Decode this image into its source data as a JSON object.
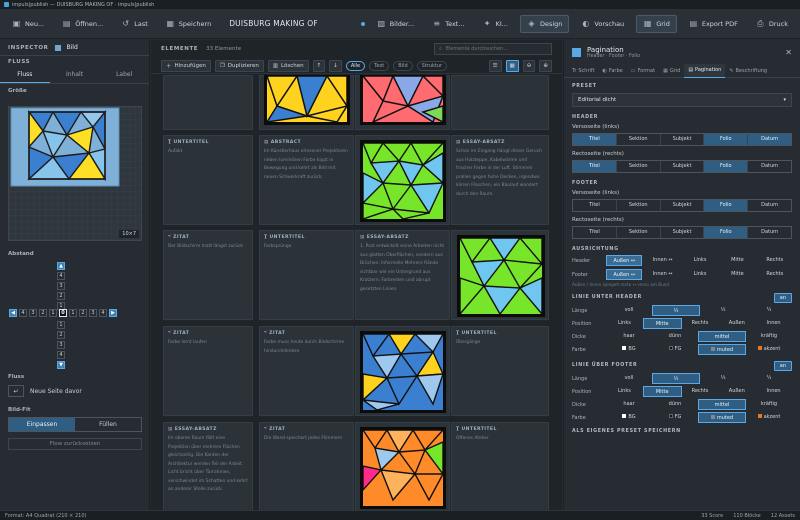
{
  "window_title": "impuls|publish — DUISBURG MAKING OF · impuls|publish",
  "toolbar": {
    "new": "Neu...",
    "open": "Öffnen...",
    "last": "Last",
    "save": "Speichern",
    "doc_title": "DUISBURG MAKING OF",
    "images": "Bilder...",
    "text": "Text...",
    "ki": "KI...",
    "design": "Design",
    "preview": "Vorschau",
    "grid": "Grid",
    "export": "Export PDF",
    "print": "Druck"
  },
  "inspector": {
    "title": "INSPECTOR",
    "object": "Bild",
    "section_flow": "FLUSS",
    "tabs": [
      "Fluss",
      "Inhalt",
      "Label"
    ],
    "size_label": "Größe",
    "size_value": "10×7",
    "spacing_label": "Abstand",
    "spacing_vertical_top": [
      "4",
      "3",
      "2",
      "1"
    ],
    "spacing_vertical_bottom": [
      "1",
      "2",
      "3",
      "4"
    ],
    "spacing_left": [
      "4",
      "3",
      "2",
      "1"
    ],
    "spacing_center": "0",
    "spacing_right": [
      "1",
      "2",
      "3",
      "4"
    ],
    "flow_label": "Fluss",
    "flow_option": "Neue Seite davor",
    "fit_label": "Bild-Fit",
    "fit_options": [
      "Einpassen",
      "Füllen"
    ],
    "reset_flow": "Flow zurücksetzen"
  },
  "elements": {
    "title": "ELEMENTE",
    "count": "33 Elemente",
    "search_placeholder": "Elemente durchsuchen...",
    "add": "Hinzufügen",
    "duplicate": "Duplizieren",
    "delete": "Löschen",
    "filters": [
      "Alle",
      "Text",
      "Bild",
      "Struktur"
    ],
    "cards": [
      {
        "tag": "UNTERTITEL",
        "text": "Aufakt"
      },
      {
        "tag": "ABSTRACT",
        "text": "Im Künstlerhaus erlesener Projektoren neben luminösen Farbe kippt in Bewegung und kehrt als Bild mit neuen Schwerkraft zurück."
      },
      {
        "tag": "ESSAY-ABSATZ",
        "text": "Schon im Eingang hängt dieser Geruch aus Holzteppe, Kabelwärme und frischer Farbe in der Luft. Stimmen prallen gegen hohe Decken, irgendwo klirren Flaschen, ein Baulauf wandert durch den Raum."
      },
      {
        "tag": "ZITAT",
        "text": "Der Bildschirm matt längst zurück"
      },
      {
        "tag": "UNTERTITEL",
        "text": "Farbsprünge"
      },
      {
        "tag": "ESSAY-ABSATZ",
        "text": "1. Post entwickelt seine Arbeiten nicht aus glatten Oberflächen, sondern aus Brüchen. Informelle Mehrere Rände sichtbar wie ein Untergrund aus Kratzern, Farbresten und abrupt gesetzten Linien."
      },
      {
        "tag": "ZITAT",
        "text": "Farbe lernt laufen"
      },
      {
        "tag": "ZITAT",
        "text": "Farbe muss heute durch Bildschirme hindurchdenken"
      },
      {
        "tag": "UNTERTITEL",
        "text": "Übergänge"
      },
      {
        "tag": "ESSAY-ABSATZ",
        "text": "Im oberen Raum fällt eine Projektion über mehrere Flächen gleichzeitig. Die Kanten der Architektur werden Teil der Arbeit. Licht bricht über Türrahmen, verschwindet im Schatten und kehrt an anderer Stelle zurück."
      },
      {
        "tag": "ZITAT",
        "text": "Die Wand speichert jedes Flimmern"
      },
      {
        "tag": "UNTERTITEL",
        "text": "Offenes Atelier"
      }
    ]
  },
  "pagination": {
    "title": "Pagination",
    "subtitle": "Header · Footer · Folio",
    "tabs": [
      "Schrift",
      "Farbe",
      "Format",
      "Grid",
      "Pagination",
      "Beschriftung"
    ],
    "preset_label": "PRESET",
    "preset_value": "Editorial dicht",
    "header_label": "HEADER",
    "verso_label": "Versoseite (links)",
    "recto_label": "Rectoseite (rechts)",
    "header_verso": [
      "Titel",
      "Sektion",
      "Subjekt",
      "Folio",
      "Datum"
    ],
    "header_recto": [
      "Titel",
      "Sektion",
      "Subjekt",
      "Folio",
      "Datum"
    ],
    "footer_label": "FOOTER",
    "footer_verso": [
      "Titel",
      "Sektion",
      "Subjekt",
      "Folio",
      "Datum"
    ],
    "footer_recto": [
      "Titel",
      "Sektion",
      "Subjekt",
      "Folio",
      "Datum"
    ],
    "align_label": "AUSRICHTUNG",
    "align_header_label": "Header",
    "align_footer_label": "Footer",
    "align_options": [
      "Außen ↔",
      "Innen ↔",
      "Links",
      "Mitte",
      "Rechts"
    ],
    "align_note": "Außen / Innen spiegelt recto ↔ verso am Bund",
    "line_header_label": "LINIE UNTER HEADER",
    "line_footer_label": "LINIE ÜBER FOOTER",
    "line_toggle": "an",
    "length_label": "Länge",
    "length_options": [
      "voll",
      "½",
      "⅓",
      "¼"
    ],
    "position_label": "Position",
    "position_options": [
      "Links",
      "Mitte",
      "Rechts",
      "Außen",
      "Innen"
    ],
    "thickness_label": "Dicke",
    "thickness_options": [
      "haar",
      "dünn",
      "mittel",
      "kräftig"
    ],
    "color_label": "Farbe",
    "color_options": [
      "BG",
      "FG",
      "muted",
      "akzent"
    ],
    "save_preset_label": "ALS EIGENES PRESET SPEICHERN"
  },
  "status": {
    "format": "Format: A4 Quadrat (210 × 210)",
    "score": "33 Score",
    "blocks": "110 Blöcke",
    "assets": "12 Assets"
  },
  "colors": {
    "accent": "#5aa9e6",
    "bg": "#252b31",
    "panel": "#262c32"
  }
}
